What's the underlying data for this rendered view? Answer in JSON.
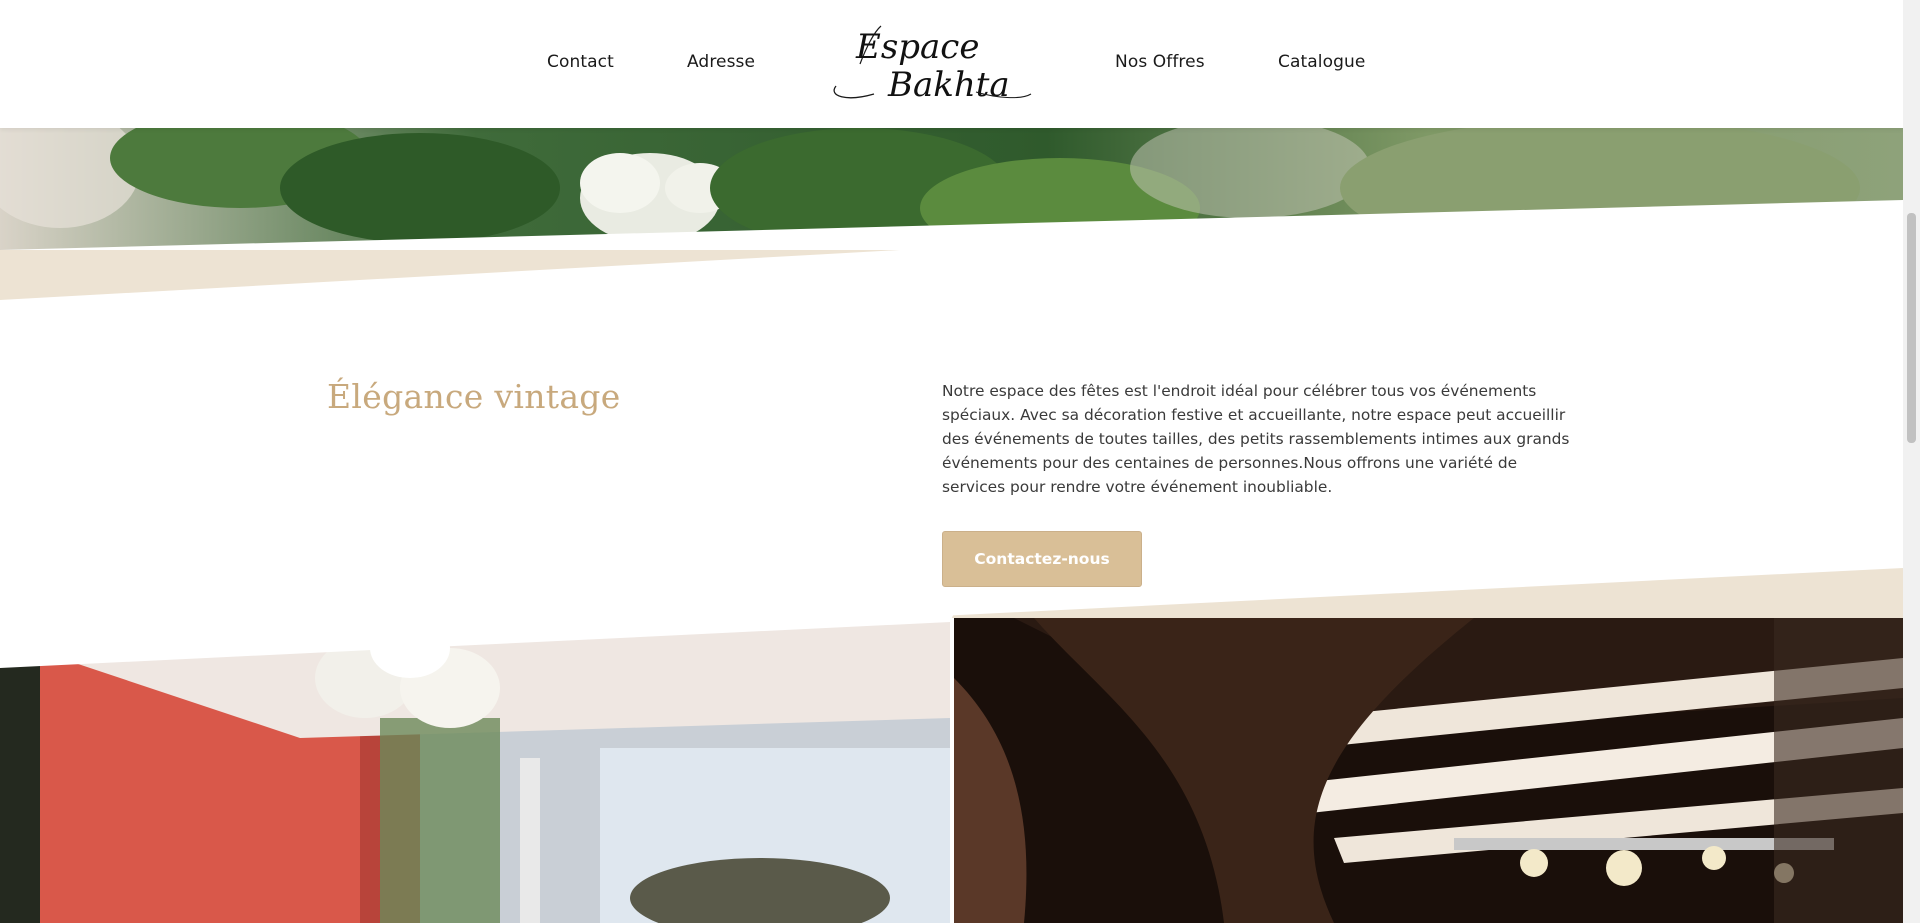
{
  "header": {
    "nav_left": [
      "Contact",
      "Adresse"
    ],
    "nav_right": [
      "Nos Offres",
      "Catalogue"
    ],
    "logo_line1": "Espace",
    "logo_line2": "Bakhta"
  },
  "main": {
    "title": "Élégance vintage",
    "body": "Notre espace des fêtes est l'endroit idéal pour célébrer tous vos événements spéciaux. Avec sa décoration festive et accueillante, notre espace peut accueillir des événements de toutes tailles, des petits rassemblements intimes aux grands événements pour des centaines de personnes.Nous offrons une variété de services pour rendre votre événement inoubliable.",
    "cta_label": "Contactez-nous"
  },
  "colors": {
    "accent": "#c8a97d",
    "button_bg": "#d9bf97",
    "beige_band": "#ede3d3"
  },
  "icons": {
    "logo": "script-logo"
  }
}
